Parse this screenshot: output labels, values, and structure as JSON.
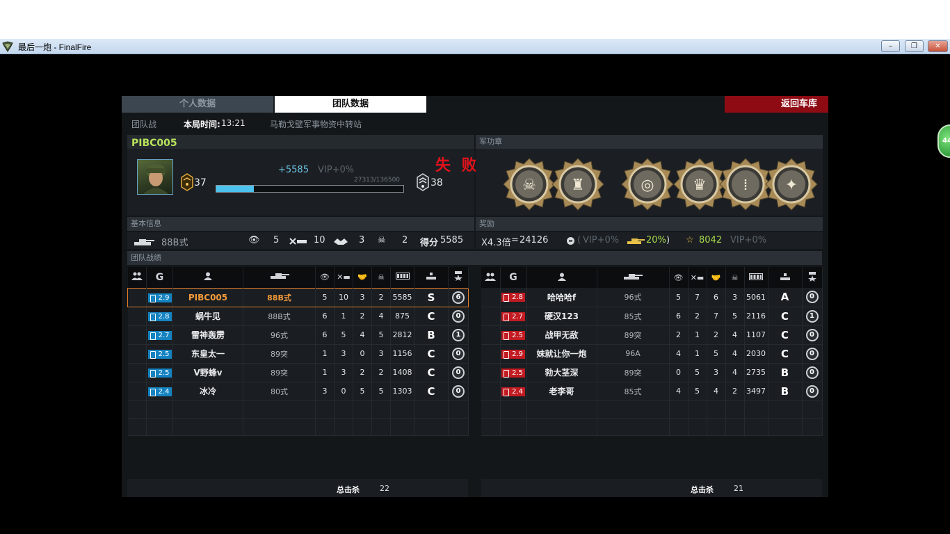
{
  "window": {
    "title": "最后一炮 - FinalFire",
    "minimize": "–",
    "restore": "❐",
    "close": "✕"
  },
  "tabs": {
    "personal": "个人数据",
    "team": "团队数据",
    "back": "返回车库"
  },
  "info": {
    "mode": "团队战",
    "time_label": "本局时间:",
    "time_value": "13:21",
    "map": "马勒戈壁军事物资中转站"
  },
  "player": {
    "name": "PIBC005",
    "rank_from": "37",
    "rank_to": "38",
    "xp_gain": "+5585",
    "vip_bonus": "VIP+0%",
    "xp_progress": "27313/136500",
    "xp_fraction": 0.2,
    "result": "失 败"
  },
  "headers": {
    "medals": "军功章",
    "basic": "基本信息",
    "rewards": "奖励",
    "team_results": "团队战绩"
  },
  "medals": [
    {
      "icon": "skull-medal-icon"
    },
    {
      "icon": "castle-medal-icon"
    },
    {
      "icon": "spiral-medal-icon"
    },
    {
      "icon": "crown-medal-icon"
    },
    {
      "icon": "bullet-medal-icon"
    },
    {
      "icon": "skull-star-medal-icon"
    }
  ],
  "basic": {
    "tank": "88B式",
    "spotted": "5",
    "kills": "10",
    "assists": "3",
    "deaths": "2",
    "score_label": "得分",
    "score": "5585"
  },
  "rewards": {
    "multiplier": "X4.3倍",
    "equals": "=",
    "amount": "24126",
    "vip_open": "(",
    "vip": "VIP+0%",
    "tank_bonus": "20%",
    "vip_close": ")",
    "stars": "8042",
    "star_vip": "VIP+0%"
  },
  "teams": {
    "left": {
      "rows": [
        {
          "rank": "2.9",
          "name": "PIBC005",
          "tank": "88B式",
          "spot": "5",
          "kill": "10",
          "assist": "3",
          "death": "2",
          "score": "5585",
          "grade": "S",
          "badge": "6",
          "self": true,
          "rank_icon": "square"
        },
        {
          "rank": "2.8",
          "name": "蜗牛见",
          "tank": "88B式",
          "spot": "6",
          "kill": "1",
          "assist": "2",
          "death": "4",
          "score": "875",
          "grade": "C",
          "badge": "0",
          "rank_icon": "square"
        },
        {
          "rank": "2.7",
          "name": "雷神轰雳",
          "tank": "96式",
          "spot": "6",
          "kill": "5",
          "assist": "4",
          "death": "5",
          "score": "2812",
          "grade": "B",
          "badge": "1",
          "rank_icon": "square"
        },
        {
          "rank": "2.5",
          "name": "东皇太一",
          "tank": "89突",
          "spot": "1",
          "kill": "3",
          "assist": "0",
          "death": "3",
          "score": "1156",
          "grade": "C",
          "badge": "0",
          "rank_icon": "bolt"
        },
        {
          "rank": "2.5",
          "name": "V野蜂v",
          "tank": "89突",
          "spot": "1",
          "kill": "3",
          "assist": "2",
          "death": "2",
          "score": "1408",
          "grade": "C",
          "badge": "0",
          "rank_icon": "bolt"
        },
        {
          "rank": "2.4",
          "name": "冰冷",
          "tank": "80式",
          "spot": "3",
          "kill": "0",
          "assist": "5",
          "death": "5",
          "score": "1303",
          "grade": "C",
          "badge": "0",
          "rank_icon": "square"
        }
      ],
      "total_label": "总击杀",
      "total_kills": "22"
    },
    "right": {
      "rows": [
        {
          "rank": "2.8",
          "name": "哈哈哈f",
          "tank": "96式",
          "spot": "5",
          "kill": "7",
          "assist": "6",
          "death": "3",
          "score": "5061",
          "grade": "A",
          "badge": "0"
        },
        {
          "rank": "2.7",
          "name": "硬汉123",
          "tank": "85式",
          "spot": "6",
          "kill": "2",
          "assist": "7",
          "death": "5",
          "score": "2116",
          "grade": "C",
          "badge": "1"
        },
        {
          "rank": "2.5",
          "name": "战甲无敌",
          "tank": "89突",
          "spot": "2",
          "kill": "1",
          "assist": "2",
          "death": "4",
          "score": "1107",
          "grade": "C",
          "badge": "0"
        },
        {
          "rank": "2.9",
          "name": "妹就让你一炮",
          "tank": "96A",
          "spot": "4",
          "kill": "1",
          "assist": "5",
          "death": "4",
          "score": "2030",
          "grade": "C",
          "badge": "0"
        },
        {
          "rank": "2.5",
          "name": "勃大茎深",
          "tank": "89突",
          "spot": "0",
          "kill": "5",
          "assist": "3",
          "death": "4",
          "score": "2735",
          "grade": "B",
          "badge": "0"
        },
        {
          "rank": "2.4",
          "name": "老李哥",
          "tank": "85式",
          "spot": "4",
          "kill": "5",
          "assist": "4",
          "death": "2",
          "score": "3497",
          "grade": "B",
          "badge": "0"
        }
      ],
      "total_label": "总击杀",
      "total_kills": "21"
    }
  },
  "side_widget": "44"
}
